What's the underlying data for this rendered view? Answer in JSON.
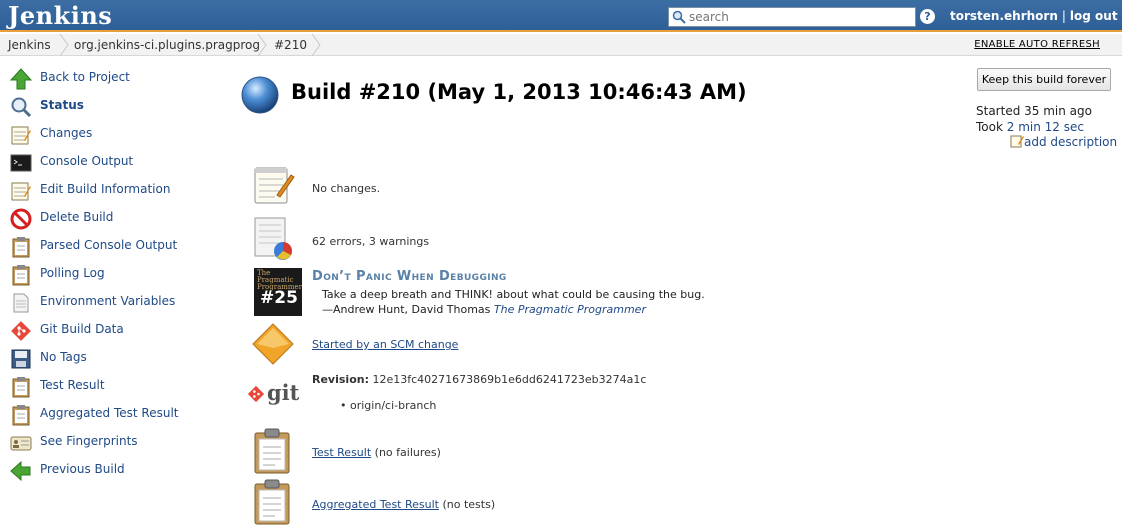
{
  "header": {
    "logo": "Jenkins",
    "search_placeholder": "search",
    "help": "?",
    "user": "torsten.ehrhorn",
    "separator": "|",
    "logout": "log out"
  },
  "breadcrumb": {
    "items": [
      "Jenkins",
      "org.jenkins-ci.plugins.pragprog",
      "#210"
    ],
    "auto_refresh": "ENABLE AUTO REFRESH"
  },
  "side_panel": {
    "items": [
      {
        "label": "Back to Project",
        "icon": "up-arrow-icon"
      },
      {
        "label": "Status",
        "icon": "magnifier-icon"
      },
      {
        "label": "Changes",
        "icon": "notepad-icon"
      },
      {
        "label": "Console Output",
        "icon": "terminal-icon"
      },
      {
        "label": "Edit Build Information",
        "icon": "notepad-icon"
      },
      {
        "label": "Delete Build",
        "icon": "no-entry-icon"
      },
      {
        "label": "Parsed Console Output",
        "icon": "clipboard-icon"
      },
      {
        "label": "Polling Log",
        "icon": "clipboard-icon"
      },
      {
        "label": "Environment Variables",
        "icon": "document-icon"
      },
      {
        "label": "Git Build Data",
        "icon": "git-icon"
      },
      {
        "label": "No Tags",
        "icon": "floppy-icon"
      },
      {
        "label": "Test Result",
        "icon": "clipboard-icon"
      },
      {
        "label": "Aggregated Test Result",
        "icon": "clipboard-icon"
      },
      {
        "label": "See Fingerprints",
        "icon": "id-card-icon"
      },
      {
        "label": "Previous Build",
        "icon": "left-arrow-icon"
      }
    ]
  },
  "main": {
    "title": "Build #210 (May 1, 2013 10:46:43 AM)",
    "keep_button": "Keep this build forever",
    "started": "Started 35 min ago",
    "took_prefix": "Took",
    "took_link": "2 min 12 sec",
    "add_description": "add description",
    "changes": "No changes.",
    "warnings": "62 errors, 3 warnings",
    "quote": {
      "badge": "#25",
      "badge_caption": "The Pragmatic Programmer",
      "title": "Don’t Panic When Debugging",
      "body": "Take a deep breath and THINK! about what could be causing the bug.",
      "attribution": "—Andrew Hunt, David Thomas",
      "book": "The Pragmatic Programmer"
    },
    "cause": "Started by an SCM change",
    "git": {
      "logo": "git",
      "revision_label": "Revision:",
      "revision": "12e13fc40271673869b1e6dd6241723eb3274a1c",
      "branch": "origin/ci-branch"
    },
    "test_result": {
      "link": "Test Result",
      "note": "(no failures)"
    },
    "aggregated_result": {
      "link": "Aggregated Test Result",
      "note": "(no tests)"
    }
  }
}
